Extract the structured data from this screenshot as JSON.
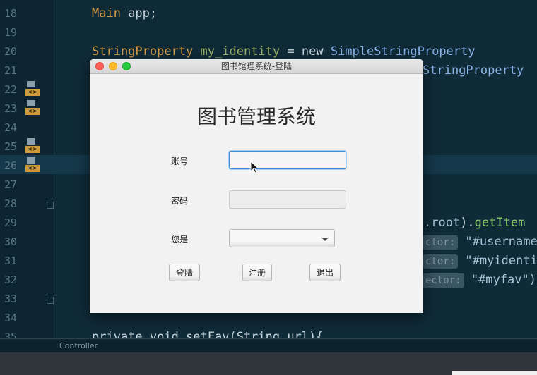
{
  "editor": {
    "line_numbers": [
      "18",
      "19",
      "20",
      "21",
      "22",
      "23",
      "24",
      "25",
      "26",
      "27",
      "28",
      "29",
      "30",
      "31",
      "32",
      "33",
      "34",
      "35"
    ],
    "gutter_tag_label": "<>",
    "code": {
      "line18": {
        "type": "Main",
        "rest": " app;"
      },
      "line20": {
        "type": "StringProperty",
        "var": " my_identity",
        "op": " = ",
        "kw": "new ",
        "cls": "SimpleStringProperty"
      },
      "line21": {
        "cls": "StringProperty"
      },
      "line29": {
        "a": ".root",
        "b": ").",
        "m": "getItem"
      },
      "line30": {
        "hint": "ctor:",
        "str": " \"#username"
      },
      "line31": {
        "hint": "ctor:",
        "str": " \"#myidenti"
      },
      "line32": {
        "hint": "ector:",
        "str": " \"#myfav\")"
      },
      "line35": {
        "text": "private void setFav(String url){"
      }
    },
    "status_label": "Controller"
  },
  "login_window": {
    "title": "图书馆理系统-登陆",
    "app_title": "图书管理系统",
    "username_label": "账号",
    "username_value": "",
    "password_label": "密码",
    "password_value": "",
    "identity_label": "您是",
    "identity_value": "",
    "buttons": {
      "login": "登陆",
      "register": "注册",
      "exit": "退出"
    }
  },
  "colors": {
    "focus_ring": "#3a8fd8",
    "traffic_close": "#fc5f57",
    "traffic_min": "#fdbc2e",
    "traffic_max": "#28c840"
  }
}
